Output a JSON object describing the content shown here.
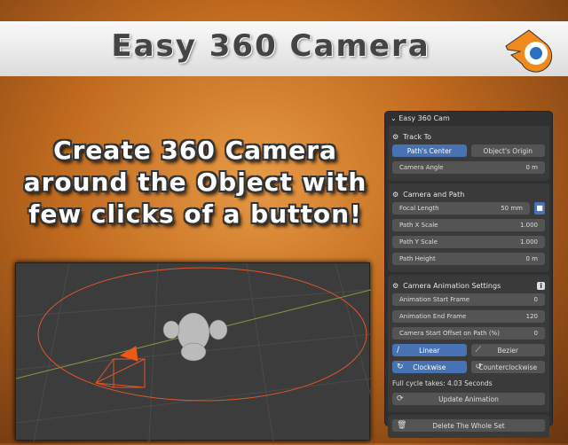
{
  "banner": {
    "title": "Easy 360 Camera",
    "logo": "blender-logo"
  },
  "promo": {
    "line1": "Create 360 Camera",
    "line2": "around the Object with",
    "line3": "few clicks of a button!"
  },
  "panel": {
    "title": "Easy 360 Cam",
    "track_to": {
      "heading": "Track To",
      "option_center": "Path's Center",
      "option_origin": "Object's Origin",
      "selected": "Path's Center",
      "camera_angle_label": "Camera Angle",
      "camera_angle_value": "0 m"
    },
    "camera_path": {
      "heading": "Camera and Path",
      "focal_label": "Focal Length",
      "focal_value": "50 mm",
      "x_label": "Path X Scale",
      "x_value": "1.000",
      "y_label": "Path Y Scale",
      "y_value": "1.000",
      "h_label": "Path Height",
      "h_value": "0 m"
    },
    "anim": {
      "heading": "Camera Animation Settings",
      "start_label": "Animation Start Frame",
      "start_value": "0",
      "end_label": "Animation End Frame",
      "end_value": "120",
      "offset_label": "Camera Start Offset on Path (%)",
      "offset_value": "0",
      "linear": "Linear",
      "bezier": "Bezier",
      "clockwise": "Clockwise",
      "counter": "Counterclockwise",
      "cycle": "Full cycle takes: 4.03 Seconds",
      "update": "Update Animation"
    },
    "delete": "Delete The Whole Set"
  },
  "colors": {
    "accent": "#4772b3",
    "path": "#e0552a"
  }
}
